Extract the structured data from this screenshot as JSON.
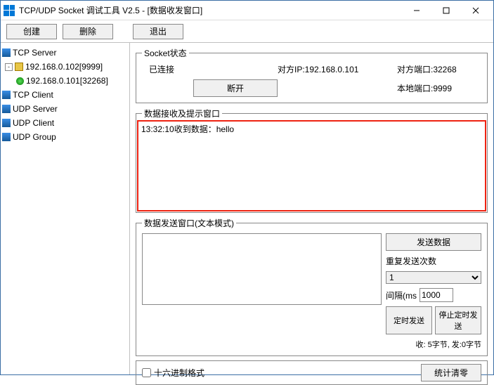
{
  "window": {
    "title": "TCP/UDP Socket 调试工具 V2.5 - [数据收发窗口]"
  },
  "toolbar": {
    "create": "创建",
    "delete": "删除",
    "exit": "退出"
  },
  "tree": {
    "tcp_server": "TCP Server",
    "ip1": "192.168.0.102[9999]",
    "ip2": "192.168.0.101[32268]",
    "tcp_client": "TCP Client",
    "udp_server": "UDP Server",
    "udp_client": "UDP Client",
    "udp_group": "UDP Group"
  },
  "status": {
    "legend": "Socket状态",
    "connected": "已连接",
    "peer_ip_label": "对方IP:192.168.0.101",
    "peer_port_label": "对方端口:32268",
    "disconnect": "断开",
    "local_port_label": "本地端口:9999"
  },
  "recv": {
    "legend": "数据接收及提示窗口",
    "line1": "13:32:10收到数据：hello"
  },
  "send": {
    "legend": "数据发送窗口(文本模式)",
    "send_btn": "发送数据",
    "repeat_label": "重复发送次数",
    "repeat_value": "1",
    "interval_label": "间隔(ms",
    "interval_value": "1000",
    "timed_send": "定时发送",
    "stop_timed": "停止定时发送",
    "stats": "收: 5字节, 发:0字节"
  },
  "footer": {
    "hex_label": "十六进制格式",
    "clear_btn": "统计清零"
  }
}
